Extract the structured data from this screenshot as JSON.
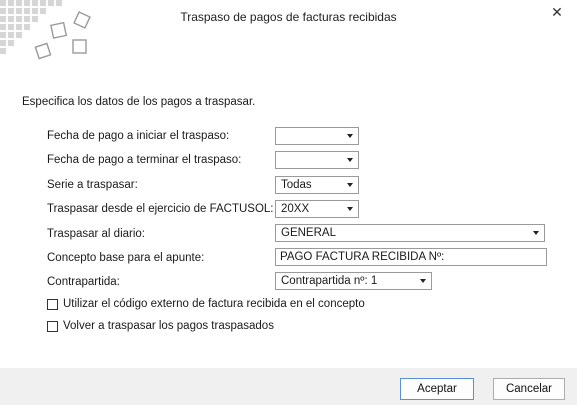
{
  "window": {
    "title": "Traspaso de pagos de facturas recibidas",
    "close_icon": "close-icon"
  },
  "intro": "Especifica los datos de los pagos a traspasar.",
  "fields": {
    "fecha_inicio": {
      "label": "Fecha de pago a iniciar el traspaso:",
      "value": ""
    },
    "fecha_fin": {
      "label": "Fecha de pago a terminar el traspaso:",
      "value": ""
    },
    "serie": {
      "label": "Serie a traspasar:",
      "value": "Todas"
    },
    "ejercicio": {
      "label": "Traspasar desde el ejercicio de FACTUSOL:",
      "value": "20XX"
    },
    "diario": {
      "label": "Traspasar al diario:",
      "value": "GENERAL"
    },
    "concepto": {
      "label": "Concepto base para el apunte:",
      "value": "PAGO FACTURA RECIBIDA Nº:"
    },
    "contrapartida": {
      "label": "Contrapartida:",
      "value": "Contrapartida nº: 1"
    }
  },
  "checkboxes": {
    "codigo_externo": {
      "label": "Utilizar el código externo de factura recibida en el concepto",
      "checked": false
    },
    "volver_traspasar": {
      "label": "Volver a traspasar los pagos traspasados",
      "checked": false
    }
  },
  "buttons": {
    "accept": "Aceptar",
    "cancel": "Cancelar"
  }
}
